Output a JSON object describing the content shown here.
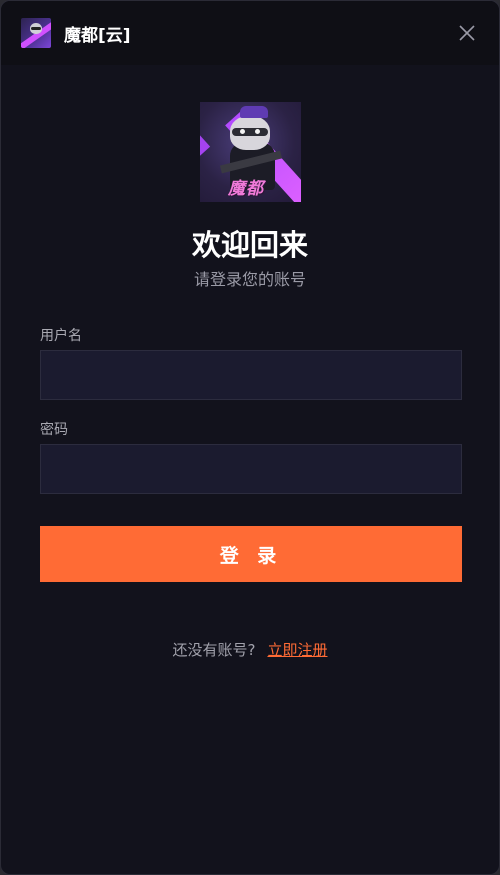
{
  "window": {
    "title": "魔都[云]",
    "close_icon": "close-icon"
  },
  "logo": {
    "brand_text": "魔都"
  },
  "header": {
    "welcome": "欢迎回来",
    "subtitle": "请登录您的账号"
  },
  "form": {
    "username_label": "用户名",
    "username_value": "",
    "password_label": "密码",
    "password_value": "",
    "login_button": "登 录"
  },
  "footer": {
    "no_account_text": "还没有账号?",
    "register_link": "立即注册"
  },
  "colors": {
    "accent": "#ff6b35",
    "background": "#12121c",
    "titlebar": "#0f0f15",
    "input_bg": "#1b1b2f"
  }
}
